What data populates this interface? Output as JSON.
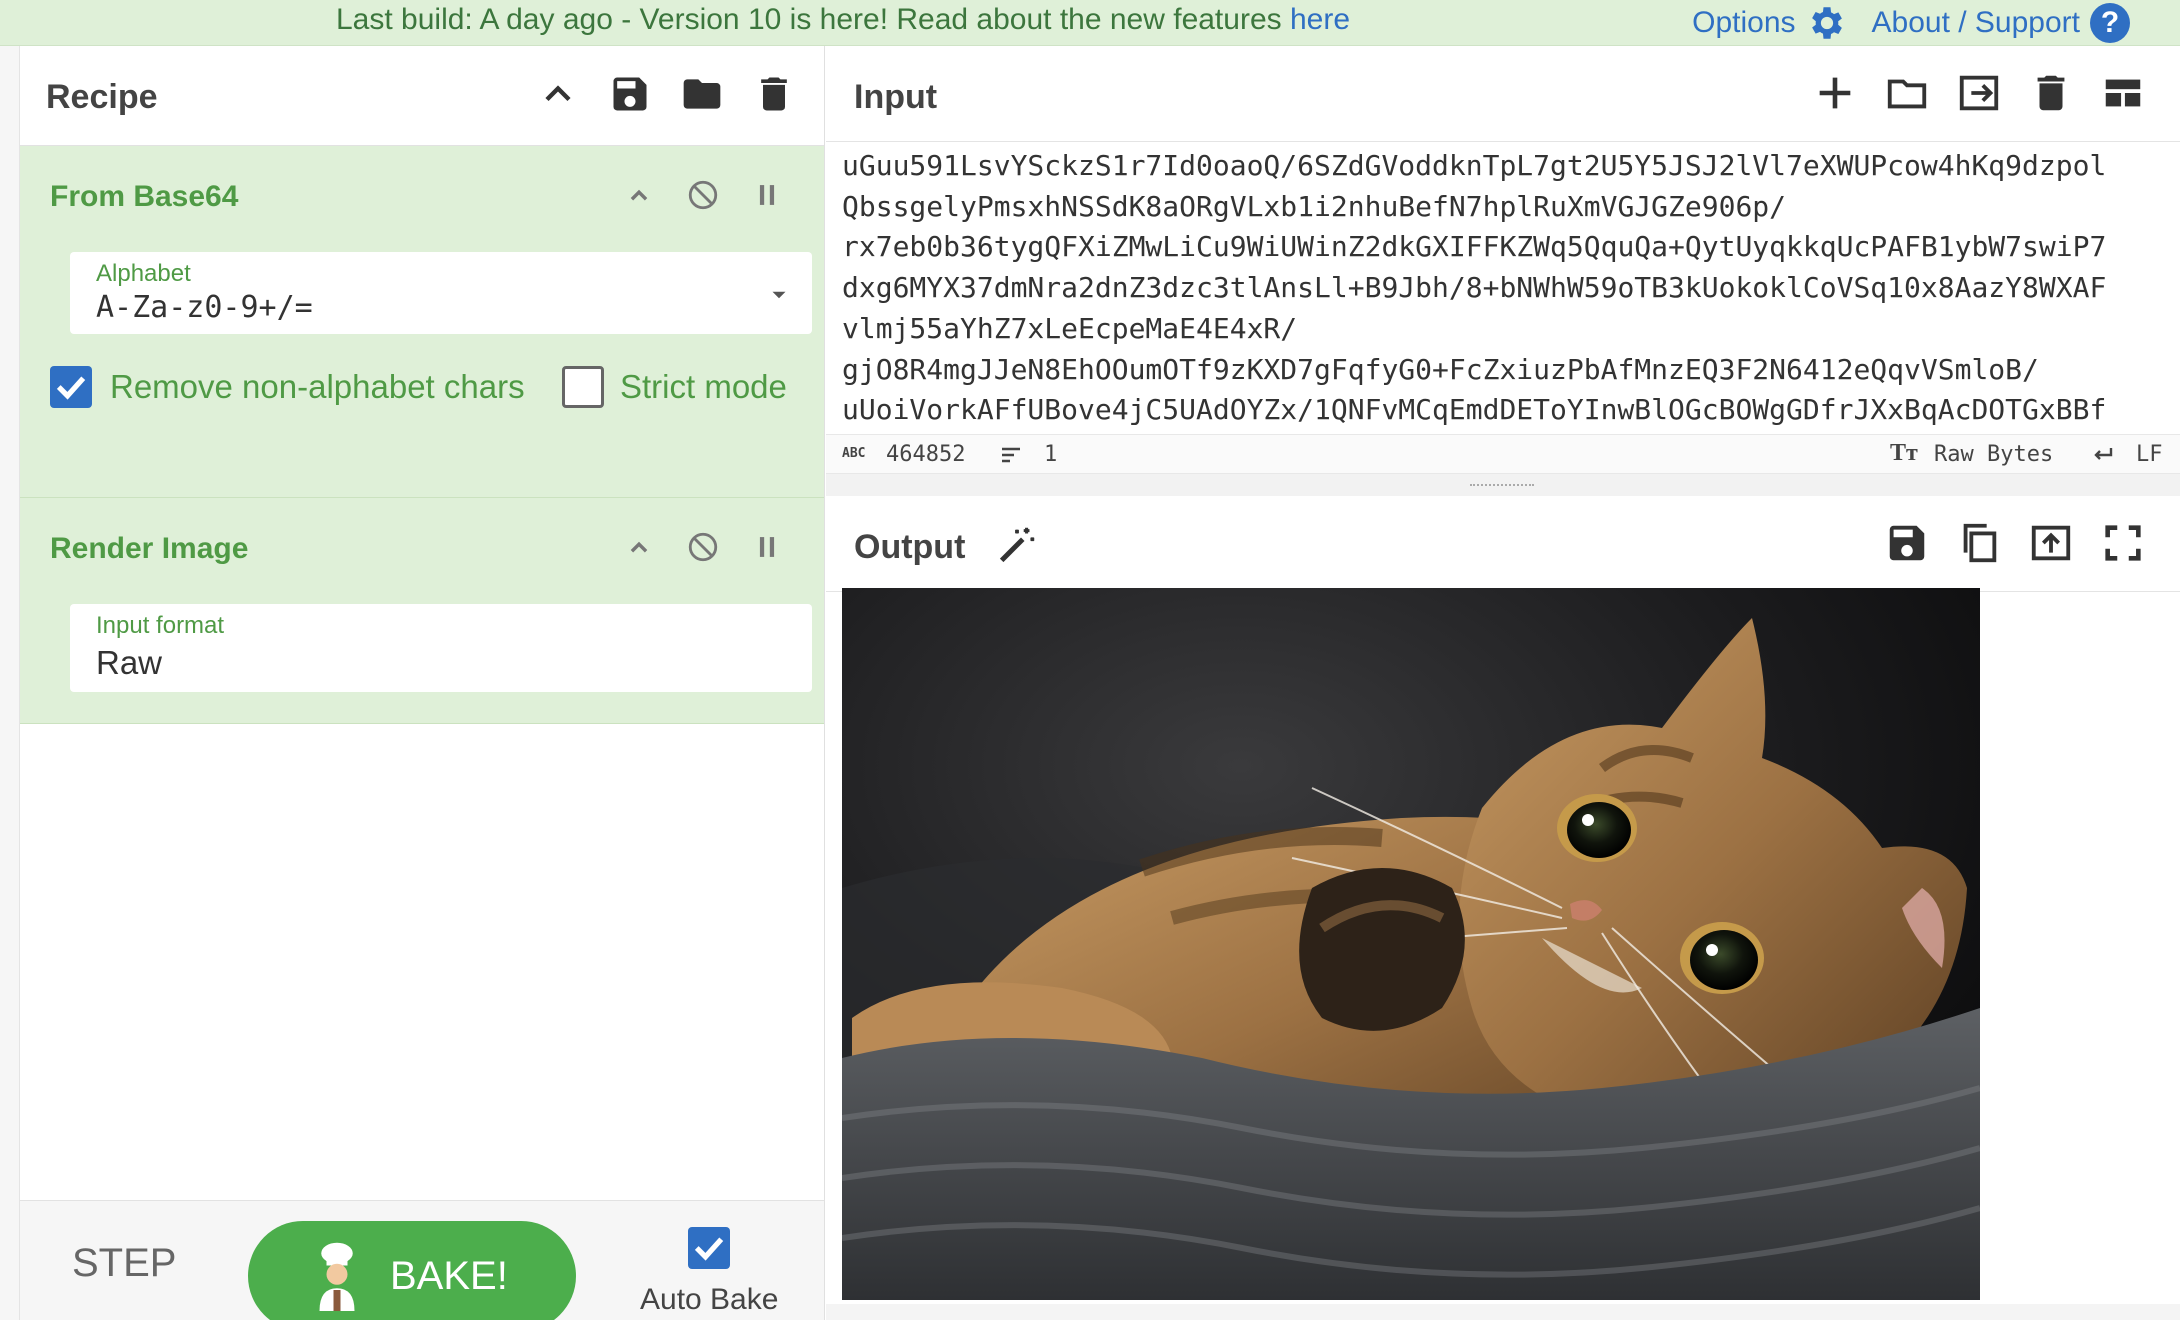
{
  "banner": {
    "message_prefix": "Last build: A day ago - Version 10 is here! Read about the new features ",
    "message_link": "here",
    "options": "Options",
    "about": "About / Support",
    "help_glyph": "?"
  },
  "recipe": {
    "title": "Recipe",
    "operations": [
      {
        "title": "From Base64",
        "alphabet_label": "Alphabet",
        "alphabet_value": "A-Za-z0-9+/=",
        "remove_non_alphabet_label": "Remove non-alphabet chars",
        "remove_non_alphabet_checked": true,
        "strict_mode_label": "Strict mode",
        "strict_mode_checked": false
      },
      {
        "title": "Render Image",
        "input_format_label": "Input format",
        "input_format_value": "Raw"
      }
    ],
    "step_label": "STEP",
    "bake_label": "BAKE!",
    "auto_bake_label": "Auto Bake",
    "auto_bake_checked": true
  },
  "input": {
    "title": "Input",
    "lines": [
      "uGuu591LsvYSckzS1r7Id0oaoQ/6SZdGVoddknTpL7gt2U5Y5JSJ2lVl7eXWUPcow4hKq9dzpol",
      "QbssgelyPmsxhNSSdK8aORgVLxb1i2nhuBefN7hplRuXmVGJGZe906p/",
      "rx7eb0b36tygQFXiZMwLiCu9WiUWinZ2dkGXIFFKZWq5QquQa+QytUyqkkqUcPAFB1ybW7swiP7",
      "dxg6MYX37dmNra2dnZ3dzc3tlAnsLl+B9Jbh/8+bNWhW59oTB3kUokoklCoVSq10x8AazY8WXAF",
      "vlmj55aYhZ7xLeEcpeMaE4E4xR/",
      "gjO8R4mgJJeN8EhOOumOTf9zKXD7gFqfyG0+FcZxiuzPbAfMnzEQ3F2N6412eQqvVSmloB/",
      "uUoiVorkAFfUBove4jC5UAdOYZx/1QNFvMCqEmdDEToYInwBlOGcBOWgGDfrJXxBqAcDOTGxBBf"
    ],
    "char_count": "464852",
    "line_count": "1",
    "encoding": "Raw Bytes",
    "eol": "LF"
  },
  "output": {
    "title": "Output"
  },
  "colors": {
    "banner_bg": "#dff0d8",
    "operation_bg": "#dff0d8",
    "operation_title": "#4f9a45",
    "link_blue": "#2f6fc3",
    "bake_green": "#4cae4c"
  },
  "icons": {
    "banner": [
      "gear-icon",
      "help-icon"
    ],
    "recipe_header": [
      "chevron-up-icon",
      "save-icon",
      "folder-icon",
      "trash-icon"
    ],
    "operation_controls": [
      "chevron-up-icon",
      "disable-icon",
      "pause-icon"
    ],
    "input_header": [
      "plus-icon",
      "folder-icon",
      "import-icon",
      "trash-icon",
      "layout-icon"
    ],
    "output_header": [
      "magic-wand-icon",
      "save-icon",
      "copy-icon",
      "upload-icon",
      "fullscreen-icon"
    ],
    "status": [
      "abc-icon",
      "lines-icon",
      "text-format-icon",
      "return-icon"
    ]
  }
}
